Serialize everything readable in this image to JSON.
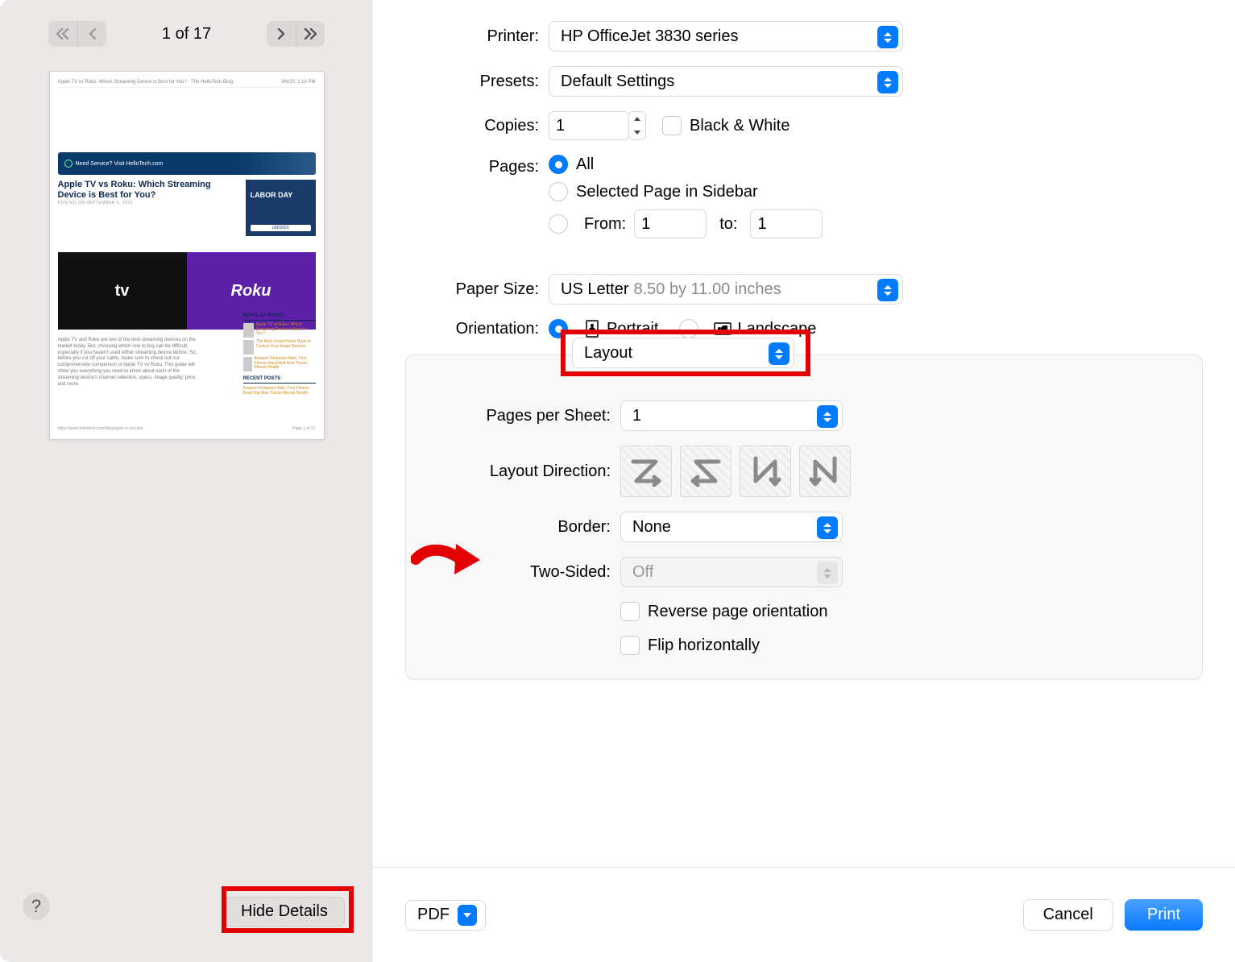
{
  "preview": {
    "page_counter": "1 of 17",
    "doc_header": "Apple TV vs Roku: Which Streaming Device is Best for You? - The HelloTech Blog",
    "doc_time": "9/6/20, 1:13 PM",
    "banner": "Need Service? Visit HelloTech.com",
    "article_title": "Apple TV vs Roku: Which Streaming Device is Best for You?",
    "posted": "POSTED ON SEPTEMBER 6, 2020",
    "ad_label": "LABOR DAY",
    "ad_code": "LBD2020",
    "tv_logo": "tv",
    "roku_logo": "Roku",
    "body": "Apple TV and Roku are two of the best streaming devices on the market today. But, choosing which one to buy can be difficult, especially if you haven't used either streaming device before. So, before you cut off your cable, make sure to check out our comprehensive comparison of Apple TV vs Roku. This guide will show you everything you need to know about each of the streaming device's channel selection, specs, image quality, price, and more.",
    "side_popular": "POPULAR POSTS",
    "side_recent": "RECENT POSTS",
    "url": "https://www.hellotech.com/blog/apple-tv-vs-roku",
    "page_of": "Page 1 of 17"
  },
  "hide_details": "Hide Details",
  "labels": {
    "printer": "Printer:",
    "presets": "Presets:",
    "copies": "Copies:",
    "black_white": "Black & White",
    "pages": "Pages:",
    "pages_all": "All",
    "pages_selected": "Selected Page in Sidebar",
    "pages_from": "From:",
    "pages_to": "to:",
    "paper_size": "Paper Size:",
    "orientation": "Orientation:",
    "portrait": "Portrait",
    "landscape": "Landscape",
    "section": "Layout",
    "pages_per_sheet": "Pages per Sheet:",
    "layout_direction": "Layout Direction:",
    "border": "Border:",
    "two_sided": "Two-Sided:",
    "reverse": "Reverse page orientation",
    "flip": "Flip horizontally"
  },
  "values": {
    "printer": "HP OfficeJet 3830 series",
    "presets": "Default Settings",
    "copies": "1",
    "from": "1",
    "to": "1",
    "paper_size": "US Letter",
    "paper_dims": "8.50 by 11.00 inches",
    "pages_per_sheet": "1",
    "border": "None",
    "two_sided": "Off"
  },
  "footer": {
    "pdf": "PDF",
    "cancel": "Cancel",
    "print": "Print"
  }
}
